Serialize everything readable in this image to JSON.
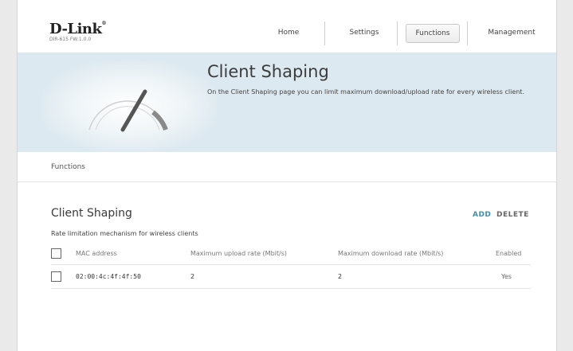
{
  "brand": {
    "logo": "D-Link",
    "firmware": "DIR-615 FW:1.0.0"
  },
  "nav": {
    "items": [
      {
        "label": "Home"
      },
      {
        "label": "Settings"
      },
      {
        "label": "Functions",
        "active": true
      },
      {
        "label": "Management"
      }
    ]
  },
  "banner": {
    "title": "Client Shaping",
    "description": "On the Client Shaping page you can limit maximum download/upload rate for every wireless client.",
    "icon": "speedometer-icon"
  },
  "breadcrumb": {
    "label": "Functions"
  },
  "section": {
    "title": "Client Shaping",
    "subtitle": "Rate limitation mechanism for wireless clients",
    "add_label": "ADD",
    "delete_label": "DELETE"
  },
  "table": {
    "headers": {
      "mac": "MAC address",
      "upload": "Maximum upload rate (Mbit/s)",
      "download": "Maximum download rate (Mbit/s)",
      "enabled": "Enabled"
    },
    "rows": [
      {
        "mac": "02:00:4c:4f:4f:50",
        "upload": "2",
        "download": "2",
        "enabled": "Yes",
        "checked": false
      }
    ]
  },
  "colors": {
    "accent": "#3f8fb4",
    "banner": "#dde9f0"
  }
}
